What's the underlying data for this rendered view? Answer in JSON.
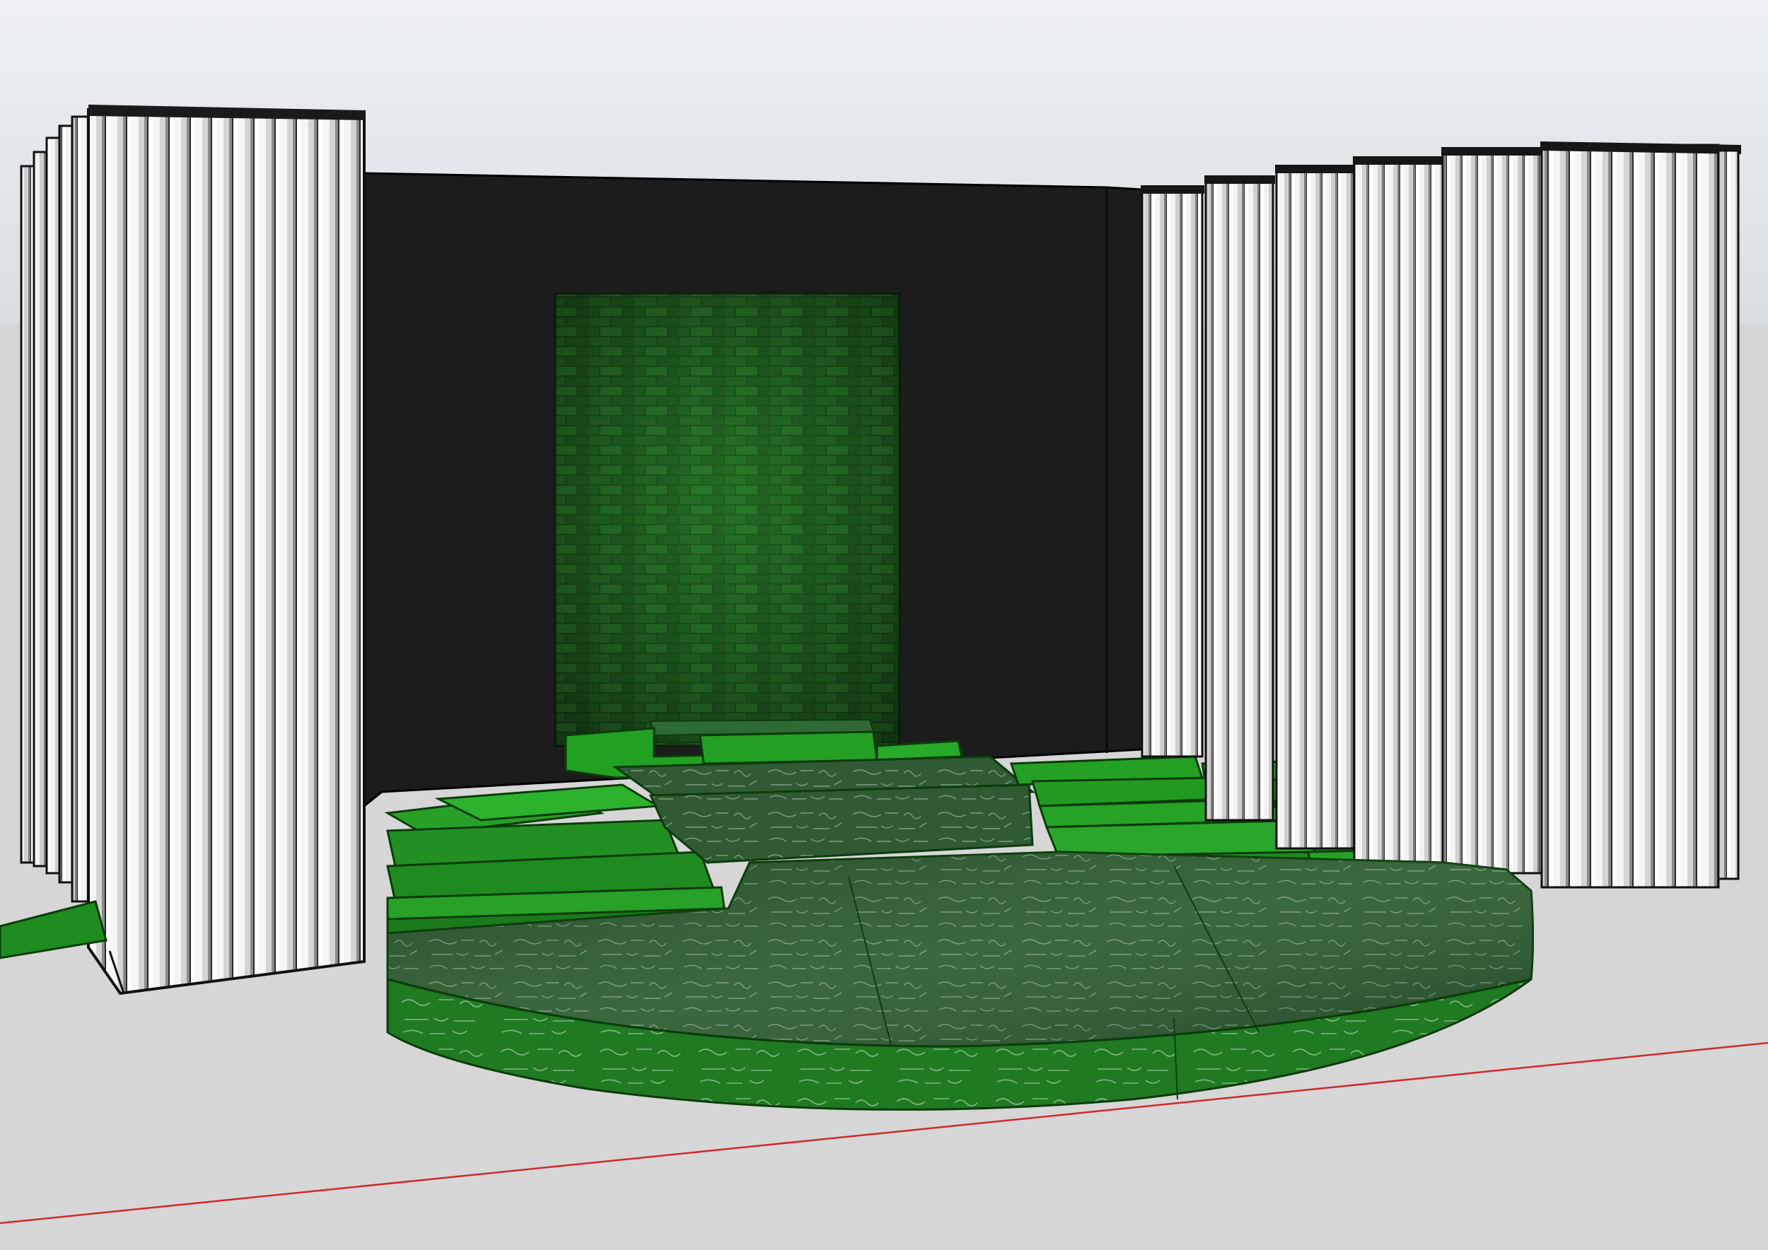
{
  "viewport": {
    "sky_color": "#e2e5e9",
    "ground_color": "#d6d6d6",
    "red_axis_color": "#d0282a"
  },
  "model": {
    "backdrop_color": "#1d1d1d",
    "curtain_color": "#f1f1f1",
    "curtain_edge_color": "#111111",
    "platform_green": "#1f7a1f",
    "step_green": "#1f9a1f",
    "brick_green": "#1b4d1b",
    "chalk_color": "#cfe3cf"
  }
}
